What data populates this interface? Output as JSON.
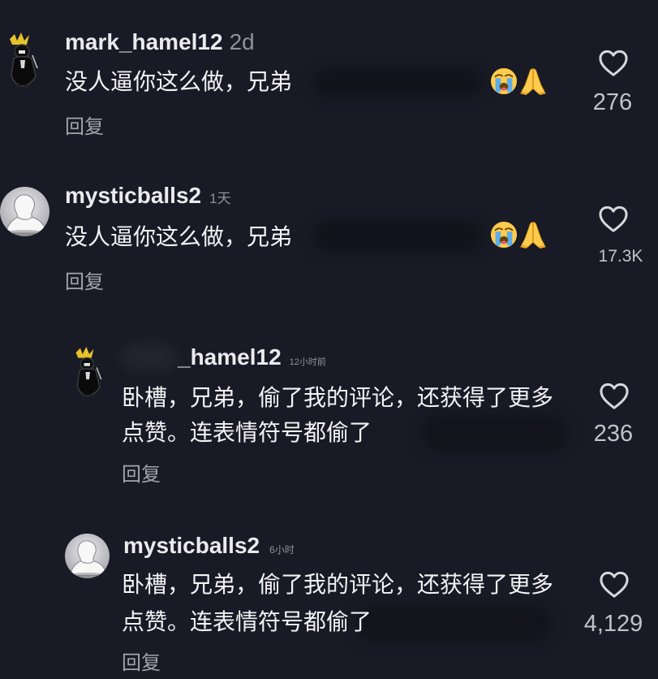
{
  "theme": {
    "background": "#181a25",
    "text": "#f3f3f5",
    "username": "#ebebee",
    "muted": "#8f919a",
    "reply": "#a3a4ab",
    "count": "#c2c3c9",
    "heart": "#d7d8dc"
  },
  "comments": [
    {
      "avatar_icon": "crowned-figure-avatar",
      "username": "mark_hamel12",
      "time": "2d",
      "text_lines": [
        "没人逼你这么做，兄弟"
      ],
      "emojis": [
        "loudly-crying-face-icon",
        "folded-hands-icon"
      ],
      "like_icon": "heart-outline-icon",
      "likes": "276",
      "reply_label": "回复"
    },
    {
      "avatar_icon": "white-bust-avatar",
      "username": "mysticballs2",
      "time": "1天",
      "text_lines": [
        "没人逼你这么做，兄弟"
      ],
      "emojis": [
        "loudly-crying-face-icon",
        "folded-hands-icon"
      ],
      "like_icon": "heart-outline-icon",
      "likes": "17.3K",
      "reply_label": "回复",
      "replies": [
        {
          "avatar_icon": "crowned-figure-avatar",
          "username": "_hamel12",
          "time": "12小时前",
          "text_lines": [
            "卧槽，兄弟，偷了我的评论，还获得了更多",
            "点赞。连表情符号都偷了"
          ],
          "like_icon": "heart-outline-icon",
          "likes": "236",
          "reply_label": "回复"
        },
        {
          "avatar_icon": "white-bust-avatar",
          "username": "mysticballs2",
          "time": "6小时",
          "text_lines": [
            "卧槽，兄弟，偷了我的评论，还获得了更多",
            "点赞。连表情符号都偷了"
          ],
          "like_icon": "heart-outline-icon",
          "likes": "4,129",
          "reply_label": "回复"
        }
      ]
    }
  ]
}
